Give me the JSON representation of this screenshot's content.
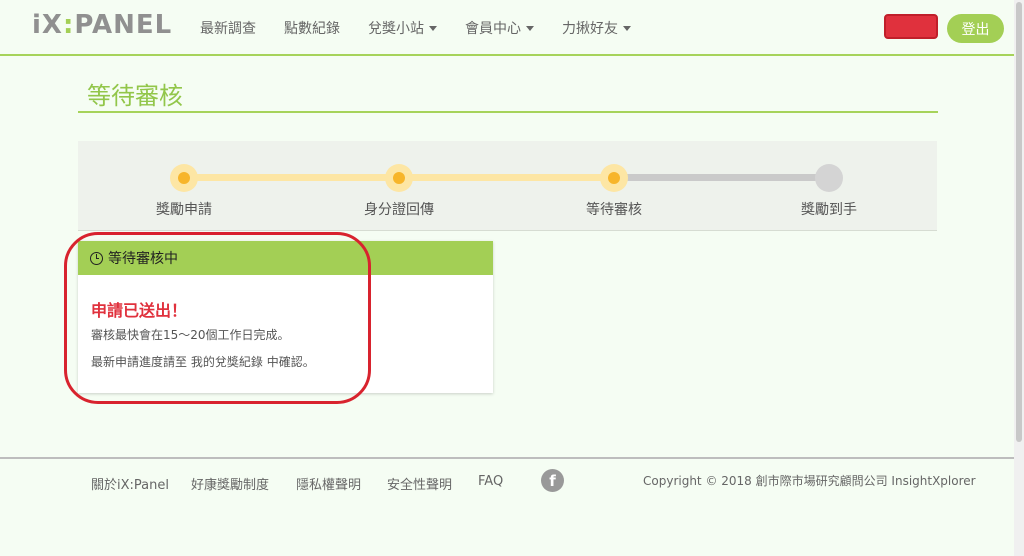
{
  "header": {
    "logo_prefix": "iX",
    "logo_colon": ":",
    "logo_suffix": "PANEL",
    "nav": [
      {
        "label": "最新調查"
      },
      {
        "label": "點數紀錄"
      },
      {
        "label": "兌獎小站"
      },
      {
        "label": "會員中心"
      },
      {
        "label": "力揪好友"
      }
    ],
    "logout_label": "登出"
  },
  "page": {
    "title": "等待審核"
  },
  "steps": [
    {
      "label": "獎勵申請",
      "state": "done"
    },
    {
      "label": "身分證回傳",
      "state": "done"
    },
    {
      "label": "等待審核",
      "state": "done"
    },
    {
      "label": "獎勵到手",
      "state": "todo"
    }
  ],
  "card": {
    "header": "等待審核中",
    "title": "申請已送出！",
    "line1": "審核最快會在15～20個工作日完成。",
    "line2_prefix": "最新申請進度請至",
    "line2_link": "我的兌獎紀錄",
    "line2_suffix": "中確認。"
  },
  "footer": {
    "links": [
      "關於iX:Panel",
      "好康獎勵制度",
      "隱私權聲明",
      "安全性聲明",
      "FAQ"
    ],
    "facebook_glyph": "f",
    "copyright": "Copyright © 2018 創市際市場研究顧問公司 InsightXplorer"
  },
  "colors": {
    "accent": "#a3cf55",
    "alert": "#e0313d",
    "step_active": "#f7b52a"
  }
}
